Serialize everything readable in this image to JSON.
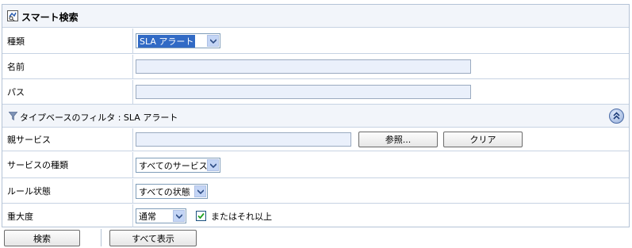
{
  "header": {
    "title": "スマート検索"
  },
  "rows": {
    "type": {
      "label": "種類",
      "value": "SLA アラート"
    },
    "name": {
      "label": "名前",
      "value": ""
    },
    "path": {
      "label": "パス",
      "value": ""
    }
  },
  "filter": {
    "title": "タイプベースのフィルタ : SLA アラート"
  },
  "filter_rows": {
    "parent_service": {
      "label": "親サービス",
      "value": "",
      "browse_label": "参照...",
      "clear_label": "クリア"
    },
    "service_type": {
      "label": "サービスの種類",
      "value": "すべてのサービス"
    },
    "rule_state": {
      "label": "ルール状態",
      "value": "すべての状態"
    },
    "severity": {
      "label": "重大度",
      "value": "通常",
      "checkbox_label": "またはそれ以上",
      "checked": true
    }
  },
  "footer": {
    "search_label": "検索",
    "show_all_label": "すべて表示"
  },
  "colors": {
    "border": "#b4c3d6",
    "field_bg": "#eaf0fb",
    "header_bg": "#f2f5fa",
    "selected": "#316ac5"
  },
  "icons": {
    "header": "search-page-icon",
    "filter": "funnel-icon",
    "collapse": "double-chevron-up-icon",
    "select_arrow": "chevron-down-icon",
    "check": "checkmark-icon"
  }
}
